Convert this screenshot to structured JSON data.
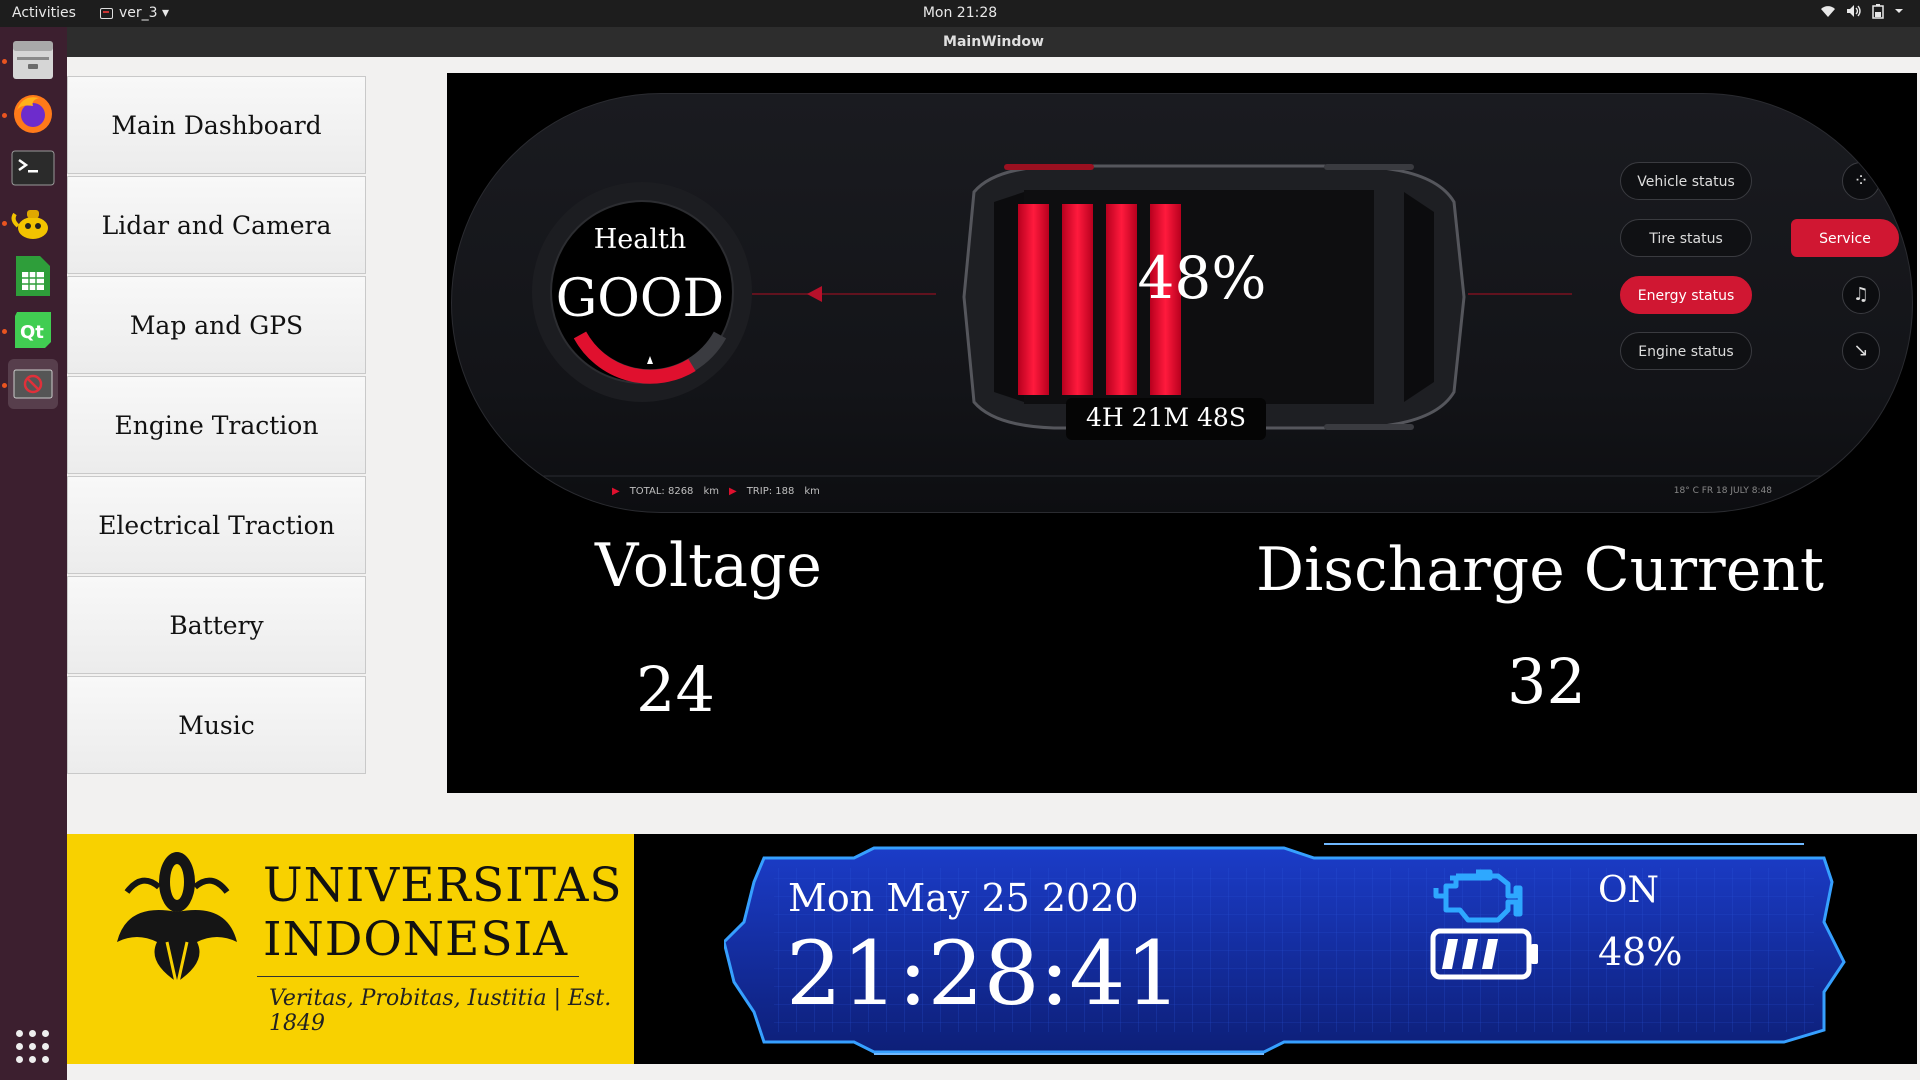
{
  "topbar": {
    "activities": "Activities",
    "app_name": "ver_3 ▾",
    "clock": "Mon 21:28",
    "tray": [
      "wifi-icon",
      "volume-icon",
      "battery-icon",
      "chevron-down-icon"
    ]
  },
  "dock": {
    "items": [
      "files-icon",
      "firefox-icon",
      "terminal-icon",
      "teapot-icon",
      "spreadsheet-icon",
      "qt-creator-icon",
      "app-window-icon"
    ],
    "show_apps": "apps-grid-icon"
  },
  "window": {
    "title": "MainWindow"
  },
  "nav": {
    "items": [
      {
        "label": "Main Dashboard"
      },
      {
        "label": "Lidar and Camera"
      },
      {
        "label": "Map and GPS"
      },
      {
        "label": "Engine Traction"
      },
      {
        "label": "Electrical Traction"
      },
      {
        "label": "Battery"
      },
      {
        "label": "Music"
      }
    ]
  },
  "dashboard": {
    "health_label": "Health",
    "health_value": "GOOD",
    "battery_percent": "48%",
    "battery_level": 0.48,
    "remaining_time": "4H 21M 48S",
    "pills": {
      "vehicle_status": "Vehicle status",
      "tire_status": "Tire status",
      "energy_status": "Energy status",
      "engine_status": "Engine status",
      "service": "Service"
    },
    "odometer": {
      "total": "TOTAL: 8268",
      "trip": "TRIP: 188",
      "unit": "km",
      "info": "18° C  FR 18 JULY  8:48"
    },
    "voltage_label": "Voltage",
    "voltage_value": "24",
    "current_label": "Discharge Current",
    "current_value": "32",
    "colors": {
      "accent_red": "#d01732",
      "panel": "#000000"
    }
  },
  "banner": {
    "name_line1": "UNIVERSITAS",
    "name_line2": "INDONESIA",
    "motto": "Veritas, Probitas, Iustitia | Est. 1849",
    "color": "#f8d100"
  },
  "hud": {
    "date": "Mon May 25 2020",
    "time": "21:28:41",
    "engine_state": "ON",
    "battery_percent": "48%",
    "battery_level": 0.75,
    "colors": {
      "frame": "#1b3cc8",
      "glow": "#36a0ff"
    }
  }
}
